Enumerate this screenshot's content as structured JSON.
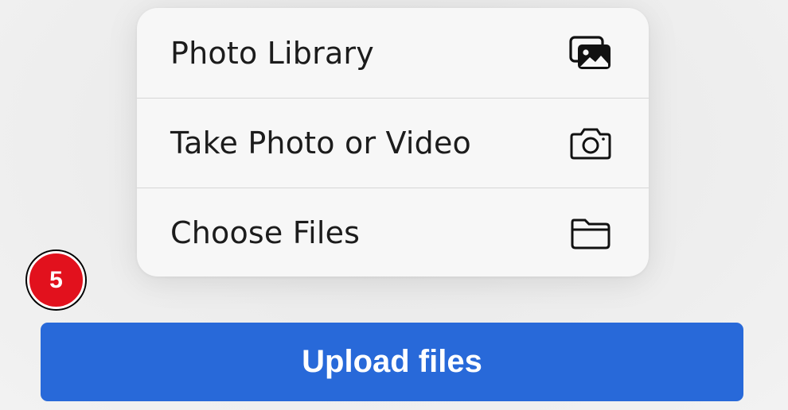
{
  "menu": {
    "items": [
      {
        "label": "Photo Library",
        "icon": "photo-library-icon"
      },
      {
        "label": "Take Photo or Video",
        "icon": "camera-icon"
      },
      {
        "label": "Choose Files",
        "icon": "folder-icon"
      }
    ]
  },
  "badge": {
    "number": "5",
    "color": "#e2111d"
  },
  "upload": {
    "label": "Upload files",
    "color": "#2869d9"
  }
}
